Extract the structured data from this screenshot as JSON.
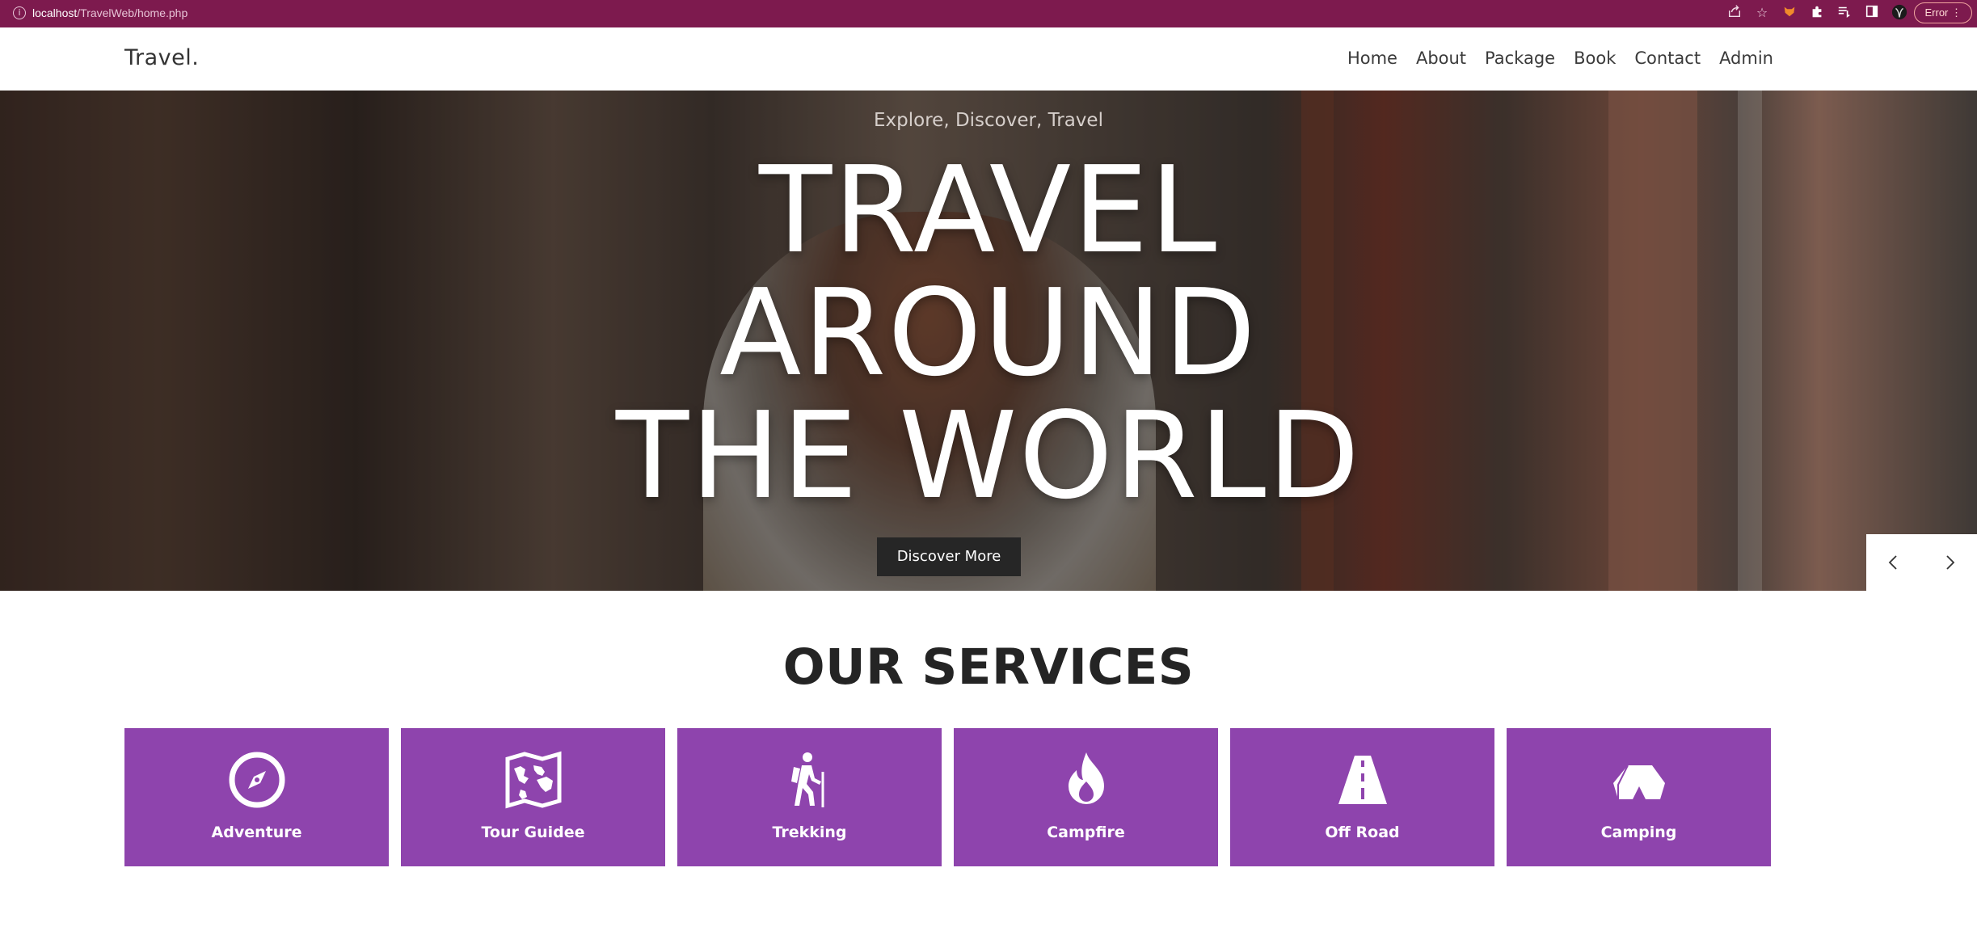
{
  "browser": {
    "url_host": "localhost",
    "url_path": "/TravelWeb/home.php",
    "icons": [
      "share-icon",
      "star-icon",
      "fox-extension-icon",
      "puzzle-icon",
      "reading-list-icon",
      "sidepanel-icon",
      "profile-avatar-icon",
      "menu-icon"
    ],
    "error_label": "Error"
  },
  "header": {
    "brand": "Travel.",
    "nav": [
      "Home",
      "About",
      "Package",
      "Book",
      "Contact",
      "Admin"
    ]
  },
  "hero": {
    "eyebrow": "Explore, Discover, Travel",
    "title_lines": [
      "TRAVEL",
      "AROUND",
      "THE WORLD"
    ],
    "cta": "Discover More",
    "slider_icons": [
      "chevron-left-icon",
      "chevron-right-icon"
    ]
  },
  "services": {
    "title": "OUR SERVICES",
    "accent": "#8e44ad",
    "items": [
      {
        "label": "Adventure",
        "icon": "compass-icon"
      },
      {
        "label": "Tour Guidee",
        "icon": "map-icon"
      },
      {
        "label": "Trekking",
        "icon": "hiker-icon"
      },
      {
        "label": "Campfire",
        "icon": "fire-icon"
      },
      {
        "label": "Off Road",
        "icon": "road-icon"
      },
      {
        "label": "Camping",
        "icon": "tent-icon"
      }
    ]
  }
}
